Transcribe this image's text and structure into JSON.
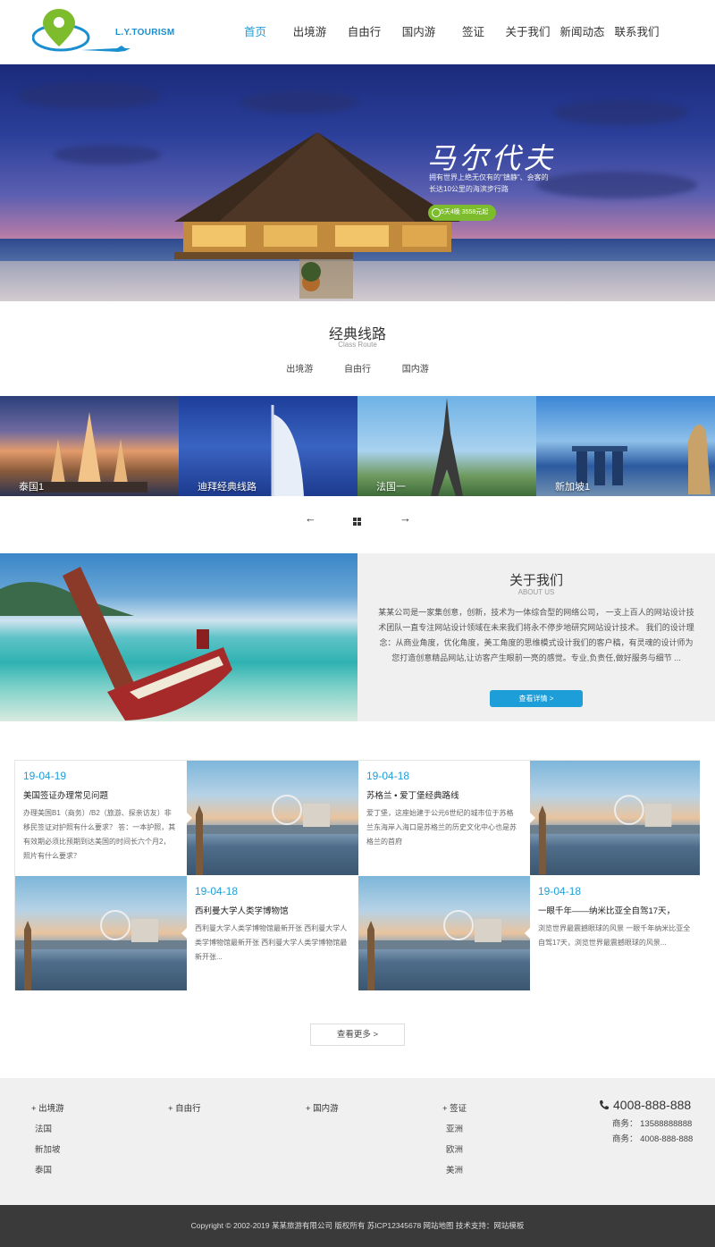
{
  "header": {
    "logo_text": "L.Y.TOURISM",
    "nav": [
      {
        "label": "首页",
        "active": true
      },
      {
        "label": "出境游",
        "active": false
      },
      {
        "label": "自由行",
        "active": false
      },
      {
        "label": "国内游",
        "active": false
      },
      {
        "label": "签证",
        "active": false
      },
      {
        "label": "关于我们",
        "active": false
      },
      {
        "label": "新闻动态",
        "active": false
      },
      {
        "label": "联系我们",
        "active": false
      }
    ]
  },
  "hero": {
    "title": "马尔代夫",
    "subtitle": "拥有世界上绝无仅有的\"镇静\"、会客的长达10公里的海滨步行路",
    "badge": "5天4晚 3558元起"
  },
  "routes": {
    "title": "经典线路",
    "subtitle": "Class Route",
    "tabs": [
      "出境游",
      "自由行",
      "国内游"
    ],
    "items": [
      {
        "label": "泰国1"
      },
      {
        "label": "迪拜经典线路"
      },
      {
        "label": "法国一"
      },
      {
        "label": "新加坡1"
      }
    ],
    "prev_icon": "arrow-left-icon",
    "grid_icon": "grid-icon",
    "next_icon": "arrow-right-icon"
  },
  "about": {
    "title": "关于我们",
    "subtitle": "ABOUT US",
    "text": "某某公司是一家集创意，创新，技术为一体综合型的网络公司， 一支上百人的网站设计技术团队一直专注网站设计领域在未来我们将永不停步地研究网站设计技术。 我们的设计理念：从商业角度，优化角度，美工角度的思维模式设计我们的客户稿，有灵魂的设计师为您打造创意精品网站,让访客产生眼前一亮的感觉。专业,负责任,做好服务与细节 ...",
    "button": "查看详情 >"
  },
  "news": [
    {
      "date": "19-04-19",
      "title": "美国签证办理常见问题",
      "desc": "办理美国B1（商务）/B2（旅游、探亲访友）非移民签证对护照有什么要求？ 答：一本护照，其有效期必须比预期到达美国的时间长六个月2，照片有什么要求？"
    },
    {
      "date": "19-04-18",
      "title": "苏格兰 • 爱丁堡经典路线",
      "desc": "爱丁堡，这座始建于公元6世纪的城市位于苏格兰东海岸入海口是苏格兰的历史文化中心也是苏格兰的首府"
    },
    {
      "date": "19-04-18",
      "title": "西利曼大学人类学博物馆",
      "desc": "西利曼大学人类学博物馆最新开张 西利曼大学人类学博物馆最新开张 西利曼大学人类学博物馆最新开张..."
    },
    {
      "date": "19-04-18",
      "title": "一眼千年——纳米比亚全自驾17天，",
      "desc": "浏览世界最震撼眼球的风景 一眼千年纳米比亚全自驾17天，浏览世界最震撼眼球的风景..."
    }
  ],
  "more_button": "查看更多 >",
  "footer": {
    "columns": [
      {
        "head": "+ 出境游",
        "items": [
          "法国",
          "新加坡",
          "泰国"
        ]
      },
      {
        "head": "+ 自由行",
        "items": []
      },
      {
        "head": "+ 国内游",
        "items": []
      },
      {
        "head": "+ 签证",
        "items": [
          "亚洲",
          "欧洲",
          "美洲"
        ]
      }
    ],
    "phone": "4008-888-888",
    "business_lines": [
      "商务： 13588888888",
      "商务： 4008-888-888"
    ],
    "copyright": "Copyright © 2002-2019 某某旅游有限公司 版权所有   苏ICP12345678   网站地图   技术支持：网站模板"
  },
  "colors": {
    "accent": "#1e9ed8",
    "badge": "#7dbc2c",
    "footer_dark": "#3a3a3a"
  }
}
